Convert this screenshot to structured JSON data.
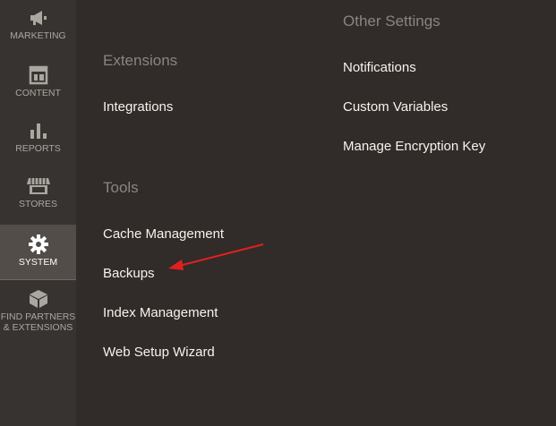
{
  "sidebar": {
    "items": [
      {
        "label": "MARKETING",
        "icon": "megaphone-icon"
      },
      {
        "label": "CONTENT",
        "icon": "layout-icon"
      },
      {
        "label": "REPORTS",
        "icon": "bar-chart-icon"
      },
      {
        "label": "STORES",
        "icon": "storefront-icon"
      },
      {
        "label": "SYSTEM",
        "icon": "gear-icon",
        "active": true
      },
      {
        "label": "FIND PARTNERS & EXTENSIONS",
        "icon": "box-icon"
      }
    ]
  },
  "panel": {
    "extensions": {
      "title": "Extensions",
      "links": [
        "Integrations"
      ]
    },
    "tools": {
      "title": "Tools",
      "links": [
        "Cache Management",
        "Backups",
        "Index Management",
        "Web Setup Wizard"
      ]
    },
    "other_settings": {
      "title": "Other Settings",
      "links": [
        "Notifications",
        "Custom Variables",
        "Manage Encryption Key"
      ]
    }
  },
  "annotation": {
    "arrow_color": "#e02020",
    "points_to": "Backups"
  }
}
